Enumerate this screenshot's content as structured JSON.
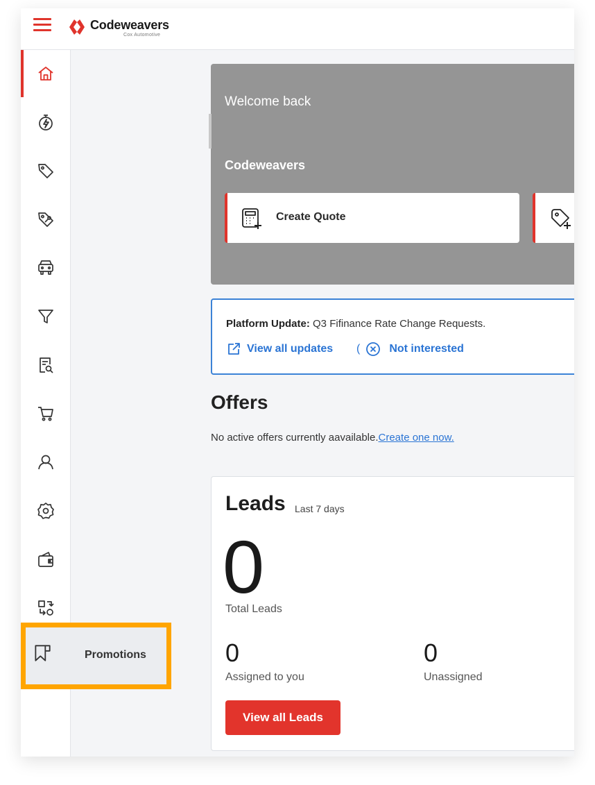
{
  "header": {
    "brand_name": "Codeweavers",
    "brand_sub": "Cox Automotive",
    "menu_icon": "hamburger-menu-icon"
  },
  "colors": {
    "accent": "#e0342c",
    "link": "#2a74d4",
    "highlight": "#ffa500",
    "hero_bg": "#959595"
  },
  "sidebar": {
    "items": [
      {
        "icon": "home-icon"
      },
      {
        "icon": "stopwatch-bolt-icon"
      },
      {
        "icon": "tag-icon"
      },
      {
        "icon": "tag-wrench-icon"
      },
      {
        "icon": "car-icon"
      },
      {
        "icon": "filter-funnel-icon"
      },
      {
        "icon": "document-search-icon"
      },
      {
        "icon": "shopping-cart-icon"
      },
      {
        "icon": "user-icon"
      },
      {
        "icon": "gear-badge-icon"
      },
      {
        "icon": "wallet-icon"
      },
      {
        "icon": "swap-arrows-icon"
      },
      {
        "icon": "bookmark-flag-icon"
      }
    ],
    "promotions_label": "Promotions"
  },
  "hero": {
    "welcome": "Welcome back",
    "company": "Codeweavers",
    "actions": [
      {
        "label": "Create Quote",
        "icon": "calculator-plus-icon"
      },
      {
        "label": "",
        "icon": "tag-plus-icon"
      }
    ]
  },
  "update": {
    "prefix": "Platform Update:",
    "message": "Q3 Fifinance Rate Change Requests.",
    "view_all": "View all updates",
    "not_interested": "Not interested",
    "paren": "("
  },
  "offers": {
    "title": "Offers",
    "text": "No active offers currently aavailable.",
    "link": "Create one now."
  },
  "leads": {
    "title": "Leads",
    "period": "Last 7 days",
    "total": "0",
    "total_label": "Total Leads",
    "assigned": "0",
    "assigned_label": "Assigned to you",
    "unassigned": "0",
    "unassigned_label": "Unassigned",
    "button": "View all Leads"
  }
}
